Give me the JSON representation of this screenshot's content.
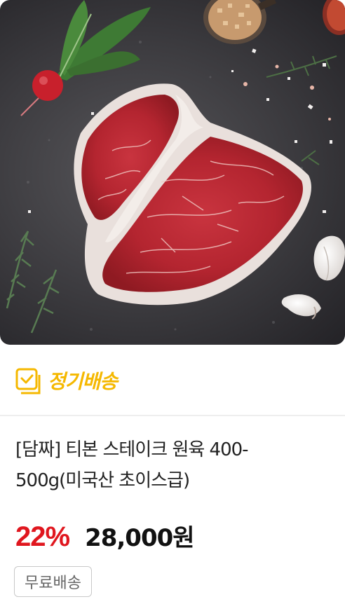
{
  "product_card": {
    "image_alt": "T-bone steak",
    "subscription_label": "정기배송",
    "title": "[담짜] 티본 스테이크 원육 400-500g(미국산 초이스급)",
    "discount_rate": "22%",
    "price": "28,000원",
    "shipping_badge": "무료배송"
  },
  "colors": {
    "accent_yellow": "#f5b800",
    "discount_red": "#e0161e",
    "price_black": "#111111"
  },
  "icons": {
    "subscription": "calendar-check-icon"
  }
}
